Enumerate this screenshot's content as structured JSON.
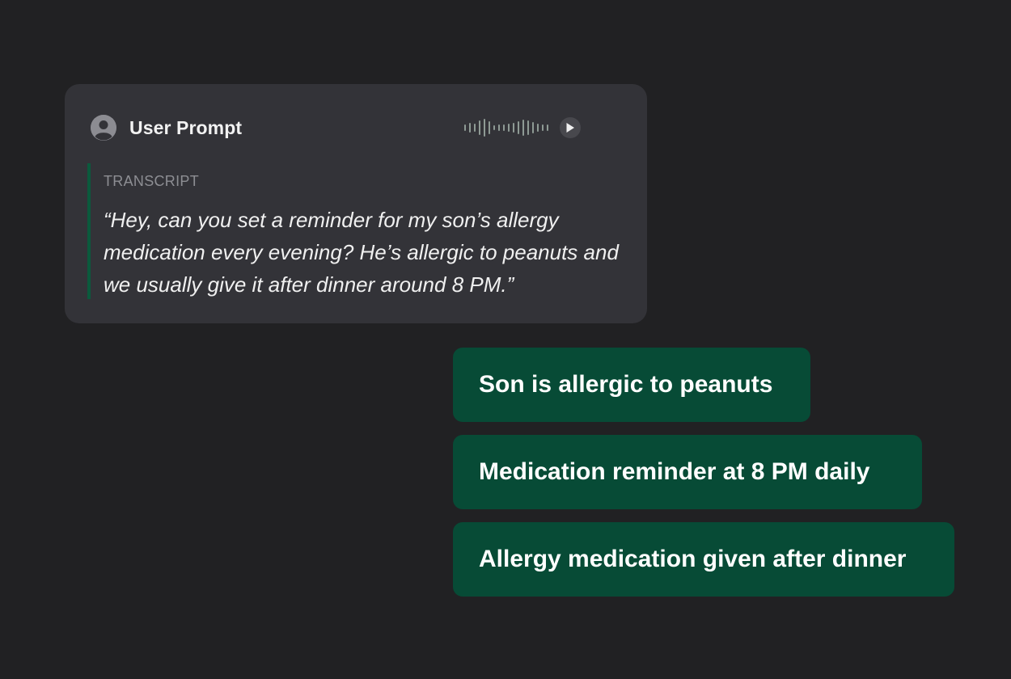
{
  "prompt_card": {
    "title": "User Prompt",
    "avatar_icon": "user-avatar-icon",
    "audio": {
      "waveform_icon": "audio-waveform-icon",
      "play_icon": "play-icon"
    },
    "transcript": {
      "label": "TRANSCRIPT",
      "text": "“Hey, can you set a reminder for my son’s allergy medication every evening? He’s allergic to peanuts and we usually give it after dinner around 8 PM.”"
    }
  },
  "extracted_facts": [
    {
      "text": "Son is allergic to peanuts"
    },
    {
      "text": "Medication reminder at 8 PM daily"
    },
    {
      "text": "Allergy medication given after dinner"
    }
  ],
  "colors": {
    "background": "#212123",
    "card": "#333338",
    "accent_green": "#074b36",
    "transcript_bar": "#0b5a3d"
  }
}
